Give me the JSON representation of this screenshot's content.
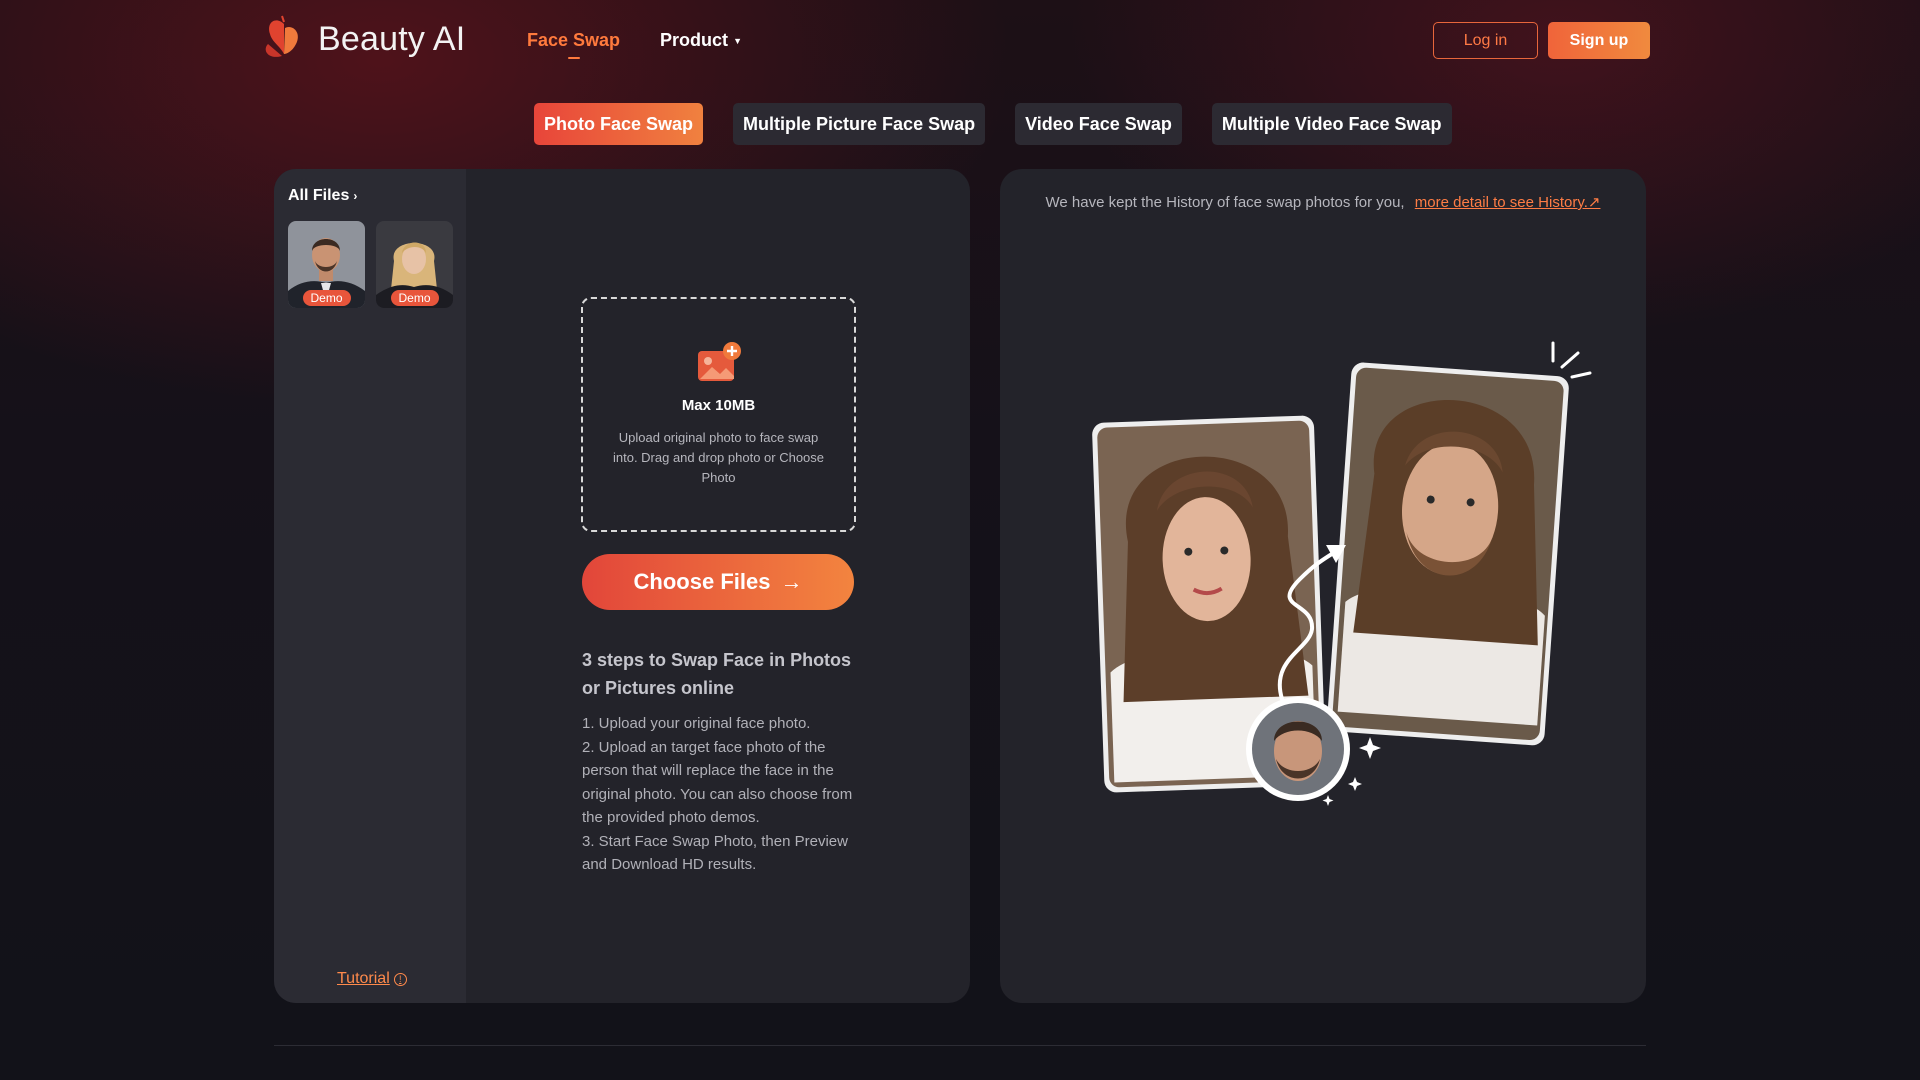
{
  "brand": {
    "name": "Beauty AI"
  },
  "nav": {
    "items": [
      {
        "label": "Face Swap",
        "active": true
      },
      {
        "label": "Product",
        "dropdown": true
      }
    ]
  },
  "auth": {
    "login_label": "Log in",
    "signup_label": "Sign up"
  },
  "tabs": [
    {
      "label": "Photo Face Swap",
      "active": true
    },
    {
      "label": "Multiple Picture Face Swap"
    },
    {
      "label": "Video Face Swap"
    },
    {
      "label": "Multiple Video Face Swap"
    }
  ],
  "sidebar": {
    "all_files_label": "All Files",
    "thumbs": [
      {
        "badge": "Demo",
        "subject": "man"
      },
      {
        "badge": "Demo",
        "subject": "woman"
      }
    ],
    "tutorial_label": "Tutorial"
  },
  "upload": {
    "max_size": "Max 10MB",
    "description": "Upload original photo to face swap into. Drag and drop photo or Choose Photo",
    "choose_label": "Choose Files"
  },
  "steps": {
    "title": "3 steps to Swap Face in Photos or Pictures online",
    "items": [
      "1. Upload your original face photo.",
      "2. Upload an target face photo of the person that will replace the face in the original photo. You can also choose from the provided photo demos.",
      "3. Start Face Swap Photo, then Preview and Download HD results."
    ]
  },
  "history": {
    "note": "We have kept the History of face swap photos for you,",
    "link": "more detail to see History.↗"
  },
  "colors": {
    "accent": "#f0643a",
    "accent_light": "#ff7a45",
    "panel": "#23232a",
    "sidebar": "#2b2b33"
  }
}
